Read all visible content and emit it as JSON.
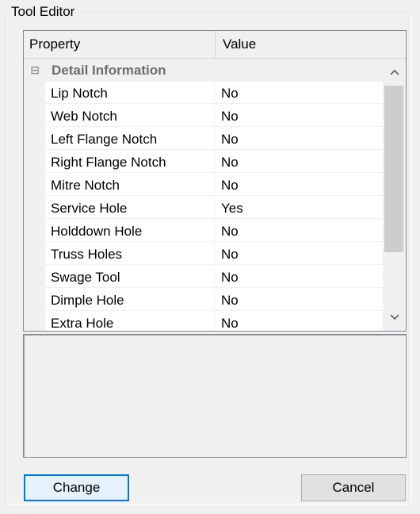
{
  "window": {
    "group_title": "Tool Editor"
  },
  "grid": {
    "headers": {
      "property": "Property",
      "value": "Value"
    },
    "category": {
      "label": "Detail Information",
      "expander": "⊟"
    },
    "rows": [
      {
        "property": "Lip Notch",
        "value": "No"
      },
      {
        "property": "Web Notch",
        "value": "No"
      },
      {
        "property": "Left Flange Notch",
        "value": "No"
      },
      {
        "property": "Right Flange Notch",
        "value": "No"
      },
      {
        "property": "Mitre Notch",
        "value": "No"
      },
      {
        "property": "Service Hole",
        "value": "Yes"
      },
      {
        "property": "Holddown Hole",
        "value": "No"
      },
      {
        "property": "Truss Holes",
        "value": "No"
      },
      {
        "property": "Swage Tool",
        "value": "No"
      },
      {
        "property": "Dimple Hole",
        "value": "No"
      },
      {
        "property": "Extra Hole",
        "value": "No"
      }
    ],
    "icons": {
      "up": "chevron-up-icon",
      "down": "chevron-down-icon"
    }
  },
  "buttons": {
    "change": "Change",
    "cancel": "Cancel"
  },
  "colors": {
    "focus_border": "#0078d7",
    "category_text": "#6d6d6d",
    "scroll_thumb": "#cdcdcd"
  }
}
